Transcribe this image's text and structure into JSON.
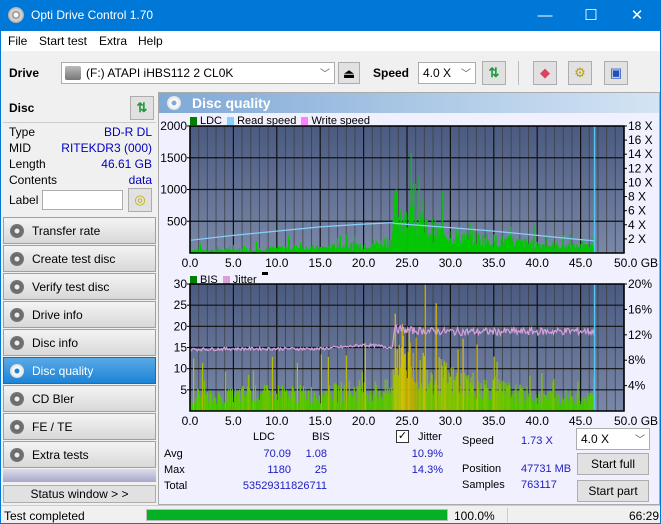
{
  "window": {
    "title": "Opti Drive Control 1.70",
    "minimize": "—",
    "maximize": "☐",
    "close": "✕"
  },
  "menu": [
    "File",
    "Start test",
    "Extra",
    "Help"
  ],
  "toolbar": {
    "drive_label": "Drive",
    "drive_value": "(F:)  ATAPI iHBS112  2 CL0K",
    "speed_label": "Speed",
    "speed_value": "4.0 X",
    "icons": [
      "eject-icon",
      "refresh-icon",
      "eraser-icon",
      "settings-icon",
      "save-icon"
    ]
  },
  "disc": {
    "header": "Disc",
    "rows": [
      {
        "label": "Type",
        "value": "BD-R DL"
      },
      {
        "label": "MID",
        "value": "RITEKDR3 (000)"
      },
      {
        "label": "Length",
        "value": "46.61 GB"
      },
      {
        "label": "Contents",
        "value": "data"
      }
    ],
    "label_label": "Label",
    "label_value": ""
  },
  "nav": [
    {
      "label": "Transfer rate",
      "active": false
    },
    {
      "label": "Create test disc",
      "active": false
    },
    {
      "label": "Verify test disc",
      "active": false
    },
    {
      "label": "Drive info",
      "active": false
    },
    {
      "label": "Disc info",
      "active": false
    },
    {
      "label": "Disc quality",
      "active": true
    },
    {
      "label": "CD Bler",
      "active": false
    },
    {
      "label": "FE / TE",
      "active": false
    },
    {
      "label": "Extra tests",
      "active": false
    }
  ],
  "status_window_button": "Status window > >",
  "panel_title": "Disc quality",
  "chart_data": [
    {
      "type": "bar",
      "title": "LDC / Read speed",
      "legend": [
        {
          "name": "LDC",
          "color": "#008000"
        },
        {
          "name": "Read speed",
          "color": "#87cefa"
        },
        {
          "name": "Write speed",
          "color": "#ff80ff"
        }
      ],
      "xlabel": "GB",
      "xlim": [
        0,
        50
      ],
      "x_ticks": [
        "0.0",
        "5.0",
        "10.0",
        "15.0",
        "20.0",
        "25.0",
        "30.0",
        "35.0",
        "40.0",
        "45.0",
        "50.0 GB"
      ],
      "ylim": [
        0,
        2000
      ],
      "y_ticks": [
        "500",
        "1000",
        "1500",
        "2000"
      ],
      "y2lim": [
        0,
        18
      ],
      "y2_ticks": [
        "2 X",
        "4 X",
        "6 X",
        "8 X",
        "10 X",
        "12 X",
        "14 X",
        "16 X",
        "18 X"
      ],
      "grid": true,
      "series": [
        {
          "name": "LDC",
          "x": [
            0,
            2,
            4,
            6,
            8,
            10,
            12,
            14,
            16,
            18,
            20,
            22,
            23.3,
            23.5,
            24,
            25,
            26,
            27,
            28,
            30,
            32,
            34,
            36,
            38,
            40,
            42,
            44,
            46,
            46.6
          ],
          "values": [
            60,
            50,
            60,
            70,
            80,
            90,
            110,
            100,
            110,
            140,
            160,
            200,
            300,
            900,
            800,
            700,
            600,
            500,
            450,
            350,
            300,
            260,
            230,
            200,
            170,
            150,
            130,
            120,
            100
          ]
        },
        {
          "name": "Read speed",
          "x": [
            0,
            5,
            10,
            15,
            20,
            23.4,
            23.5,
            30,
            35,
            40,
            45,
            46.6
          ],
          "values": [
            1.8,
            2.5,
            3.1,
            3.7,
            4.1,
            4.3,
            4.2,
            3.6,
            3.1,
            2.5,
            1.9,
            1.73
          ]
        }
      ],
      "end_marker_x": 46.61
    },
    {
      "type": "bar",
      "title": "BIS / Jitter",
      "legend": [
        {
          "name": "BIS",
          "color": "#008000"
        },
        {
          "name": "Jitter",
          "color": "#d8a0d8"
        }
      ],
      "xlabel": "GB",
      "xlim": [
        0,
        50
      ],
      "x_ticks": [
        "0.0",
        "5.0",
        "10.0",
        "15.0",
        "20.0",
        "25.0",
        "30.0",
        "35.0",
        "40.0",
        "45.0",
        "50.0 GB"
      ],
      "ylim": [
        0,
        30
      ],
      "y_ticks": [
        "5",
        "10",
        "15",
        "20",
        "25",
        "30"
      ],
      "y2lim": [
        0,
        20
      ],
      "y2_ticks": [
        "4%",
        "8%",
        "12%",
        "16%",
        "20%"
      ],
      "grid": true,
      "series": [
        {
          "name": "BIS",
          "x": [
            0,
            2,
            4,
            6,
            8,
            10,
            12,
            14,
            16,
            18,
            20,
            22,
            23.3,
            23.5,
            24,
            25,
            26,
            27,
            28,
            30,
            32,
            34,
            36,
            38,
            40,
            42,
            44,
            46,
            46.6
          ],
          "values": [
            5,
            4,
            4,
            5,
            5,
            5,
            5,
            5,
            5,
            6,
            6,
            6,
            6,
            20,
            18,
            16,
            14,
            12,
            11,
            9,
            8,
            7,
            6,
            5,
            4,
            4,
            4,
            4,
            4
          ]
        },
        {
          "name": "Jitter",
          "x": [
            0,
            5,
            10,
            15,
            18,
            20,
            22,
            23.3,
            23.5,
            25,
            30,
            35,
            40,
            45,
            46.6
          ],
          "values": [
            9.7,
            9.8,
            9.8,
            9.8,
            10.1,
            10.4,
            10.2,
            10.0,
            13.0,
            12.7,
            12.5,
            12.5,
            12.5,
            12.6,
            12.5
          ]
        }
      ],
      "end_marker_x": 46.61
    }
  ],
  "stats": {
    "col_ldc": "LDC",
    "col_bis": "BIS",
    "jitter_label": "Jitter",
    "jitter_checked": true,
    "rows": [
      {
        "label": "Avg",
        "ldc": "70.09",
        "bis": "1.08",
        "jitter": "10.9%"
      },
      {
        "label": "Max",
        "ldc": "1180",
        "bis": "25",
        "jitter": "14.3%"
      },
      {
        "label": "Total",
        "ldc": "53529311",
        "bis": "826711",
        "jitter": ""
      }
    ],
    "speed_label": "Speed",
    "speed_value": "1.73 X",
    "position_label": "Position",
    "position_value": "47731 MB",
    "samples_label": "Samples",
    "samples_value": "763117",
    "speed_select": "4.0 X",
    "start_full": "Start full",
    "start_part": "Start part"
  },
  "statusbar": {
    "text": "Test completed",
    "progress": 100.0,
    "progress_text": "100.0%",
    "time": "66:29",
    "progress_color": "#06b025"
  }
}
